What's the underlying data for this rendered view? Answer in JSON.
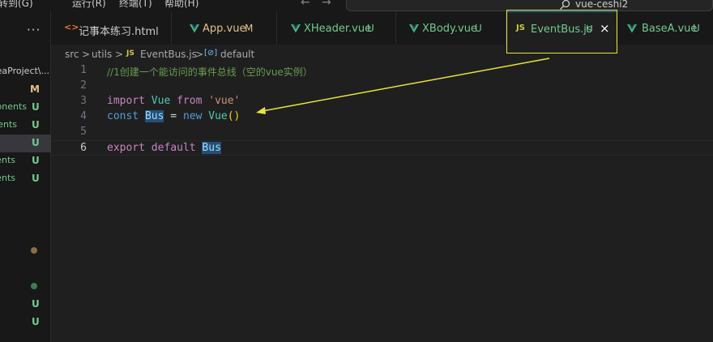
{
  "colors": {
    "keyword": "#c586c0",
    "storage": "#569cd6",
    "variable": "#9cdcfe",
    "class": "#4ec9b0",
    "string": "#ce9178",
    "comment": "#6a9955",
    "bracket": "#ffd700",
    "plain": "#d4d4d4",
    "modified": "#e2c08d",
    "untracked": "#73c991",
    "vue": "#41b883",
    "js": "#cbcb41",
    "annotation": "#e8e43a"
  },
  "menubar": {
    "items": [
      "转到(G)",
      "运行(R)",
      "终端(T)",
      "帮助(H)"
    ],
    "back_icon": "arrow-left-icon",
    "forward_icon": "arrow-right-icon",
    "search_icon": "search-icon",
    "search_text": "vue-ceshi2"
  },
  "sidebar": {
    "more_icon": "ellipsis-icon",
    "more_label": "···",
    "rows": [
      {
        "name": "eaProject\\...",
        "badge": ""
      },
      {
        "name": "",
        "badge": "M"
      },
      {
        "name": "onents",
        "badge": "U"
      },
      {
        "name": "ents",
        "badge": "U"
      },
      {
        "name": "",
        "badge": "U"
      },
      {
        "name": "nents",
        "badge": "U"
      },
      {
        "name": "ents",
        "badge": "U"
      }
    ],
    "lower_badges": [
      "U",
      "U"
    ]
  },
  "tabs": [
    {
      "icon": "html-icon",
      "icon_glyph": "<>",
      "label": "记事本练习.html",
      "badge": ""
    },
    {
      "icon": "vue-icon",
      "label": "App.vue",
      "badge": "M"
    },
    {
      "icon": "vue-icon",
      "label": "XHeader.vue",
      "badge": "U"
    },
    {
      "icon": "vue-icon",
      "label": "XBody.vue",
      "badge": "U"
    },
    {
      "icon": "js-icon",
      "icon_glyph": "JS",
      "label": "EventBus.js",
      "badge": "U",
      "close": "×"
    },
    {
      "icon": "vue-icon",
      "label": "BaseA.vue",
      "badge": "U"
    }
  ],
  "breadcrumb": {
    "items": [
      "src",
      "utils",
      "EventBus.js",
      "default"
    ],
    "separator": ">",
    "file_icon": "JS",
    "symbol_icon": "symbol-variable-icon",
    "symbol_glyph": "[⊘]"
  },
  "editor": {
    "current_line": 6,
    "line_numbers": [
      "1",
      "2",
      "3",
      "4",
      "5",
      "6"
    ],
    "code": {
      "l1": "//1创建一个能访问的事件总线（空的vue实例）",
      "l3_import": "import",
      "l3_vue": "Vue",
      "l3_from": "from",
      "l3_str": "'vue'",
      "l4_const": "const",
      "l4_bus": "Bus",
      "l4_eq": "=",
      "l4_new": "new",
      "l4_vue": "Vue",
      "l4_parens": "()",
      "l6_export": "export",
      "l6_default": "default",
      "l6_bus": "Bus"
    }
  }
}
